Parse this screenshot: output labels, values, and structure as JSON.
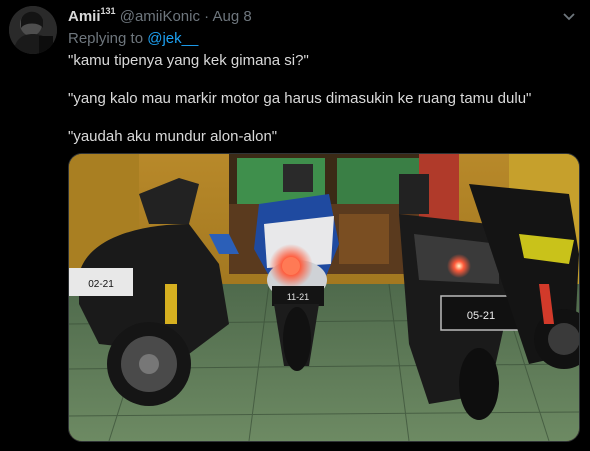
{
  "tweet": {
    "display_name": "Amii",
    "display_name_superscript": "131",
    "handle": "@amiiKonic",
    "separator": "·",
    "date": "Aug 8",
    "replying_prefix": "Replying to",
    "replying_to": "@jek__",
    "lines": [
      "\"kamu tipenya yang kek gimana si?\"",
      "\"yang kalo mau markir motor ga harus dimasukin ke ruang tamu dulu\"",
      "\"yaudah aku mundur alon-alon\""
    ],
    "plates": [
      "02-21",
      "11-21",
      "05-21"
    ]
  },
  "colors": {
    "background": "#000000",
    "text": "#d9d9d9",
    "muted": "#6e767d",
    "accent": "#1da1f2"
  },
  "icons": {
    "more": "chevron-down-icon"
  }
}
